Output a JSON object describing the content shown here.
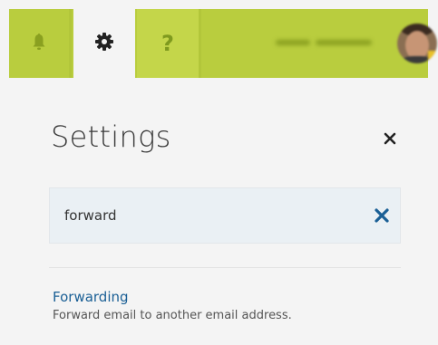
{
  "topbar": {
    "tabs": [
      {
        "name": "notifications",
        "icon": "bell-icon"
      },
      {
        "name": "settings",
        "icon": "gear-icon",
        "active": true
      },
      {
        "name": "help",
        "icon": "help-icon",
        "label": "?"
      }
    ],
    "accent_color": "#b9cd3e",
    "icon_color": "#8aa020"
  },
  "panel": {
    "title": "Settings",
    "close_icon": "close-icon",
    "search": {
      "value": "forward",
      "clear_icon": "clear-search-icon"
    },
    "results": [
      {
        "title": "Forwarding",
        "description": "Forward email to another email address."
      }
    ],
    "link_color": "#1a5f95"
  }
}
